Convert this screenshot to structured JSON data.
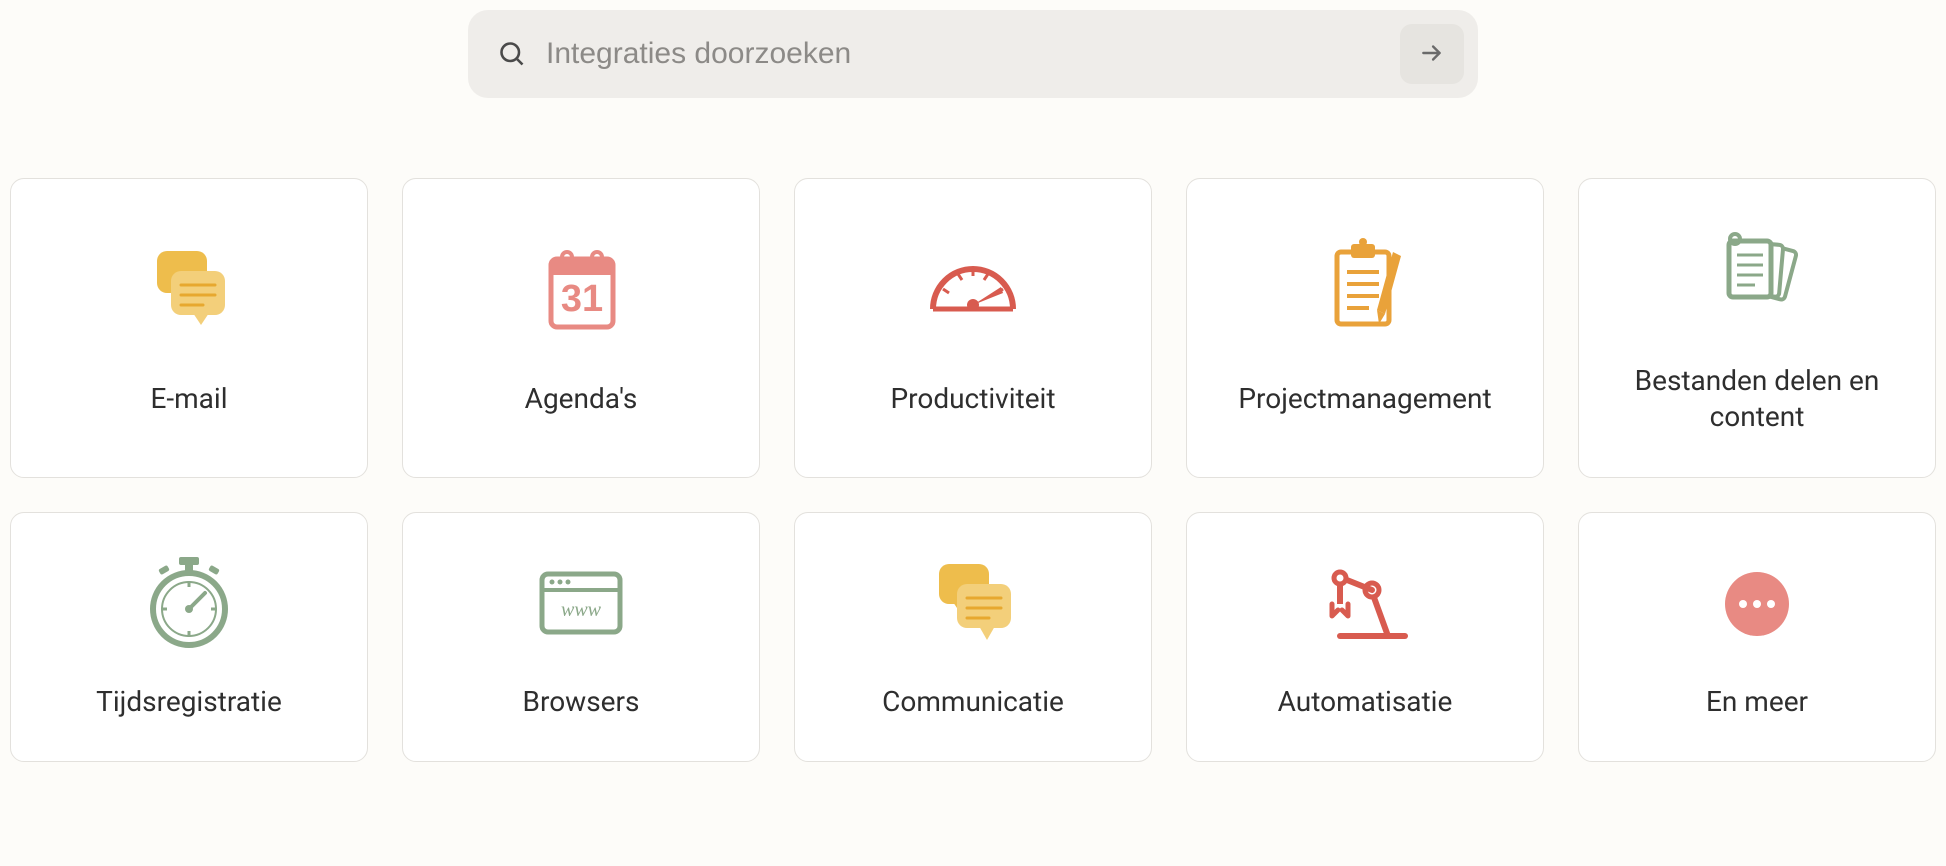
{
  "search": {
    "placeholder": "Integraties doorzoeken"
  },
  "categories": [
    {
      "id": "email",
      "label": "E-mail"
    },
    {
      "id": "agendas",
      "label": "Agenda's"
    },
    {
      "id": "productivity",
      "label": "Productiviteit"
    },
    {
      "id": "project-management",
      "label": "Projectmanagement"
    },
    {
      "id": "file-sharing",
      "label": "Bestanden delen en content"
    },
    {
      "id": "time-tracking",
      "label": "Tijdsregistratie"
    },
    {
      "id": "browsers",
      "label": "Browsers"
    },
    {
      "id": "communication",
      "label": "Communicatie"
    },
    {
      "id": "automation",
      "label": "Automatisatie"
    },
    {
      "id": "more",
      "label": "En meer"
    }
  ],
  "colors": {
    "yellow": "#eebd4c",
    "pink": "#e88a83",
    "red": "#d85b4f",
    "orange": "#e9a23a",
    "green": "#8ba889"
  }
}
